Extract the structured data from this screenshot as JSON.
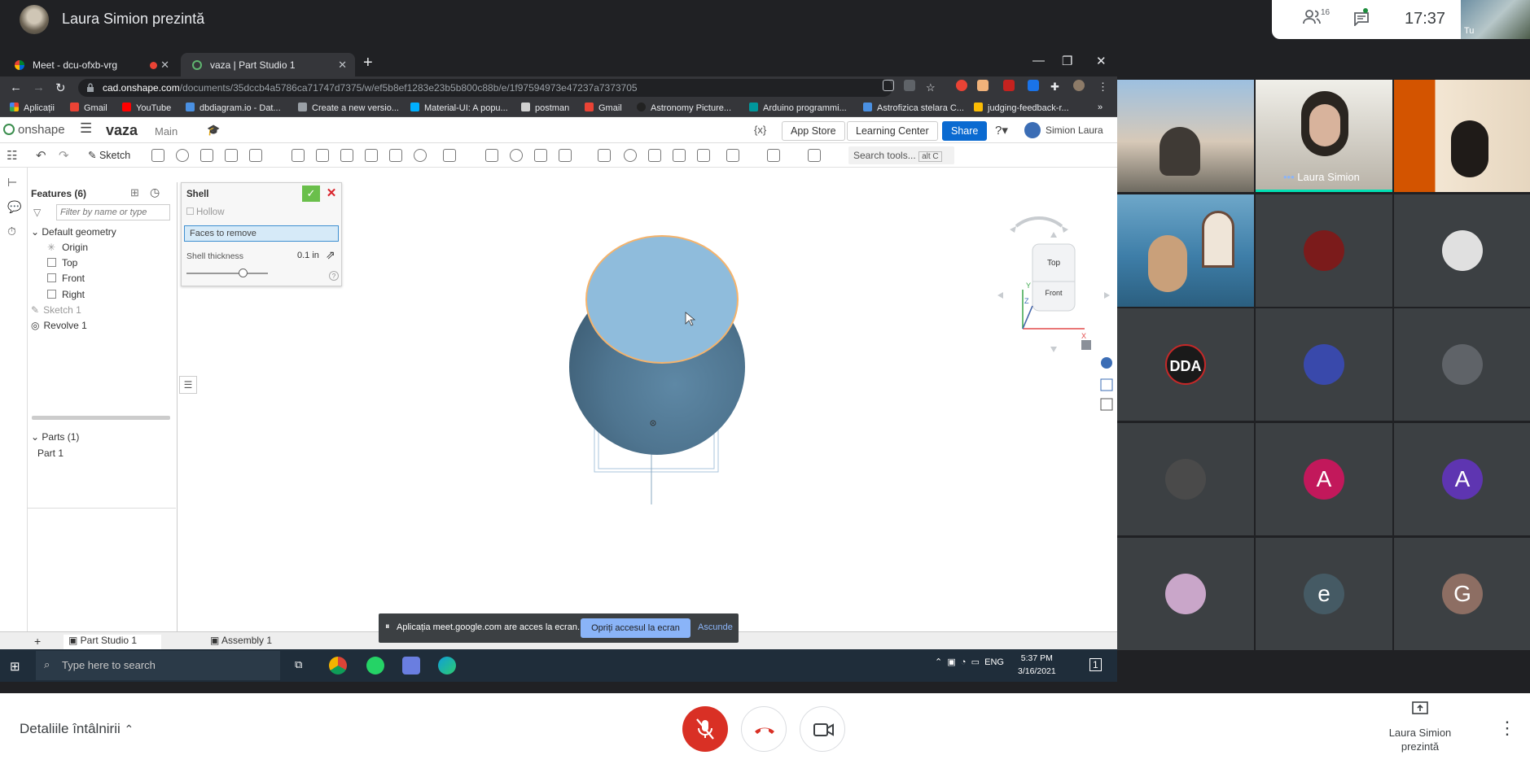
{
  "meet": {
    "presenter_title": "Laura Simion prezintă",
    "people_count": "16",
    "clock": "17:37",
    "self_label": "Tu",
    "meeting_details": "Detaliile întâlnirii",
    "presenting_label": "Laura Simion prezintă",
    "colors": {
      "bg": "#202124",
      "mic_off": "#d93025",
      "hangup": "#d93025"
    }
  },
  "browser": {
    "tabs": [
      {
        "label": "Meet - dcu-ofxb-vrg"
      },
      {
        "label": "vaza | Part Studio 1"
      }
    ],
    "url_host": "cad.onshape.com",
    "url_path": "/documents/35dccb4a5786ca71747d7375/w/ef5b8ef1283e23b5b800c88b/e/1f97594973e47237a7373705",
    "bookmarks": [
      "Aplicații",
      "Gmail",
      "YouTube",
      "dbdiagram.io - Dat...",
      "Create a new versio...",
      "Material-UI: A popu...",
      "postman",
      "Gmail",
      "Astronomy Picture...",
      "Arduino programmi...",
      "Astrofizica stelara C...",
      "judging-feedback-r..."
    ]
  },
  "onshape": {
    "logo": "onshape",
    "doc_name": "vaza",
    "branch": "Main",
    "app_store": "App Store",
    "learning_center": "Learning Center",
    "share": "Share",
    "user": "Simion Laura",
    "sketch": "Sketch",
    "search_tools": "Search tools...",
    "search_shortcut": "alt C",
    "features_title": "Features (6)",
    "filter_placeholder": "Filter by name or type",
    "default_geometry": "Default geometry",
    "features": [
      "Origin",
      "Top",
      "Front",
      "Right",
      "Sketch 1",
      "Revolve 1"
    ],
    "parts_title": "Parts (1)",
    "parts": [
      "Part 1"
    ],
    "shell": {
      "title": "Shell",
      "hollow": "Hollow",
      "faces": "Faces to remove",
      "thickness_label": "Shell thickness",
      "thickness_value": "0.1 in",
      "slider_level": 0.72
    },
    "viewcube": {
      "top": "Top",
      "front": "Front",
      "axis_x": "X",
      "axis_y": "Y",
      "axis_z": "Z"
    },
    "bottom_tabs": [
      "Part Studio 1",
      "Assembly 1"
    ],
    "model_color": "#5e88a5",
    "selected_face_color": "#8fbcdc",
    "highlight_color": "#f5b36b"
  },
  "share_notice": {
    "text": "Aplicația meet.google.com are acces la ecran.",
    "stop": "Opriți accesul la ecran",
    "hide": "Ascunde"
  },
  "windows": {
    "search": "Type here to search",
    "lang": "ENG",
    "time": "5:37 PM",
    "date": "3/16/2021",
    "notif": "1"
  },
  "participants": {
    "featured_name": "Laura Simion",
    "avatars": [
      {
        "letter": "A",
        "color": "#c2185b"
      },
      {
        "letter": "A",
        "color": "#5e35b1"
      },
      {
        "letter": "e",
        "color": "#455a64"
      },
      {
        "letter": "G",
        "color": "#8d6e63"
      }
    ]
  }
}
